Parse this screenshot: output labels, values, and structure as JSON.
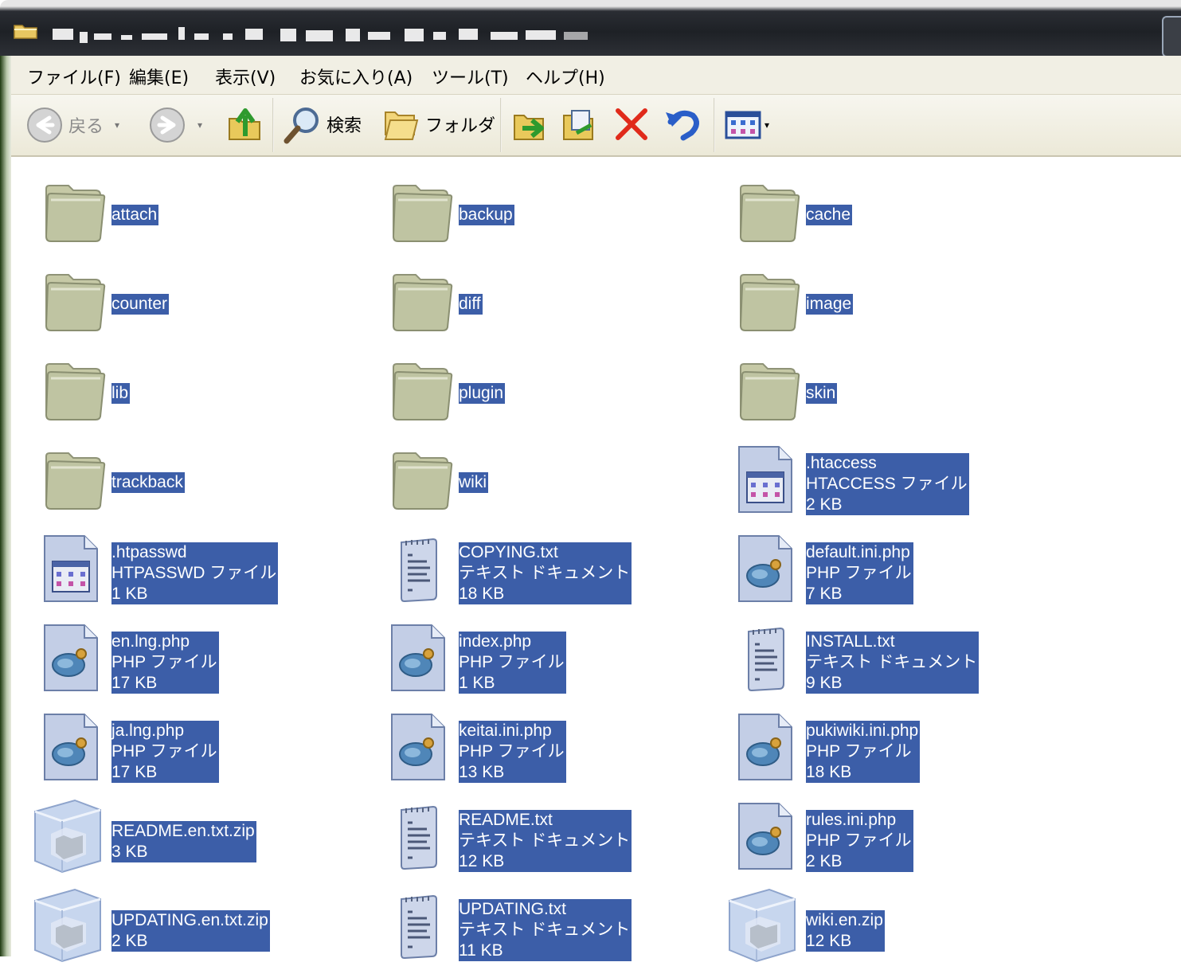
{
  "window": {
    "title": ""
  },
  "menu": [
    "ファイル(F)",
    "編集(E)",
    "表示(V)",
    "お気に入り(A)",
    "ツール(T)",
    "ヘルプ(H)"
  ],
  "toolbar": {
    "back_label": "戻る",
    "search_label": "検索",
    "folders_label": "フォルダ"
  },
  "colors": {
    "selection": "#3c5ea8",
    "menubar": "#f1efe4",
    "titlebar": "#23262b"
  },
  "files": [
    {
      "name": "attach",
      "kind": "folder"
    },
    {
      "name": "backup",
      "kind": "folder"
    },
    {
      "name": "cache",
      "kind": "folder"
    },
    {
      "name": "counter",
      "kind": "folder"
    },
    {
      "name": "diff",
      "kind": "folder"
    },
    {
      "name": "image",
      "kind": "folder"
    },
    {
      "name": "lib",
      "kind": "folder"
    },
    {
      "name": "plugin",
      "kind": "folder"
    },
    {
      "name": "skin",
      "kind": "folder"
    },
    {
      "name": "trackback",
      "kind": "folder"
    },
    {
      "name": "wiki",
      "kind": "folder"
    },
    {
      "name": ".htaccess",
      "type": "HTACCESS ファイル",
      "size": "2 KB",
      "kind": "sys"
    },
    {
      "name": ".htpasswd",
      "type": "HTPASSWD ファイル",
      "size": "1 KB",
      "kind": "sys"
    },
    {
      "name": "COPYING.txt",
      "type": "テキスト ドキュメント",
      "size": "18 KB",
      "kind": "txt"
    },
    {
      "name": "default.ini.php",
      "type": "PHP ファイル",
      "size": "7 KB",
      "kind": "php"
    },
    {
      "name": "en.lng.php",
      "type": "PHP ファイル",
      "size": "17 KB",
      "kind": "php"
    },
    {
      "name": "index.php",
      "type": "PHP ファイル",
      "size": "1 KB",
      "kind": "php"
    },
    {
      "name": "INSTALL.txt",
      "type": "テキスト ドキュメント",
      "size": "9 KB",
      "kind": "txt"
    },
    {
      "name": "ja.lng.php",
      "type": "PHP ファイル",
      "size": "17 KB",
      "kind": "php"
    },
    {
      "name": "keitai.ini.php",
      "type": "PHP ファイル",
      "size": "13 KB",
      "kind": "php"
    },
    {
      "name": "pukiwiki.ini.php",
      "type": "PHP ファイル",
      "size": "18 KB",
      "kind": "php"
    },
    {
      "name": "README.en.txt.zip",
      "size": "3 KB",
      "kind": "zip"
    },
    {
      "name": "README.txt",
      "type": "テキスト ドキュメント",
      "size": "12 KB",
      "kind": "txt"
    },
    {
      "name": "rules.ini.php",
      "type": "PHP ファイル",
      "size": "2 KB",
      "kind": "php"
    },
    {
      "name": "UPDATING.en.txt.zip",
      "size": "2 KB",
      "kind": "zip"
    },
    {
      "name": "UPDATING.txt",
      "type": "テキスト ドキュメント",
      "size": "11 KB",
      "kind": "txt"
    },
    {
      "name": "wiki.en.zip",
      "size": "12 KB",
      "kind": "zip"
    }
  ]
}
